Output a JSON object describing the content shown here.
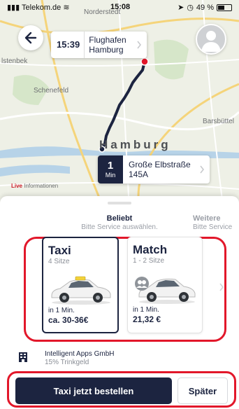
{
  "status_bar": {
    "carrier": "Telekom.de",
    "time": "15:08",
    "battery": "49 %",
    "battery_level": 0.49
  },
  "map": {
    "places": {
      "norderstedt": "Norderstedt",
      "elstenbek": "lstenbek",
      "schenefeld": "Schenefeld",
      "barsbuettel": "Barsbüttel",
      "hamburg": "Hamburg"
    },
    "attribution": {
      "live": "Live",
      "text": "Informationen"
    },
    "route_color": "#1c2440",
    "destination_color": "#e2172a"
  },
  "destination": {
    "time": "15:39",
    "line1": "Flughafen",
    "line2": "Hamburg"
  },
  "origin": {
    "minutes": "1",
    "unit": "Min",
    "line1": "Große Elbstraße",
    "line2": "145A"
  },
  "tabs": [
    {
      "title": "Beliebt",
      "subtitle": "Bitte Service auswählen."
    },
    {
      "title": "Weitere",
      "subtitle": "Bitte Service"
    }
  ],
  "services": [
    {
      "name": "Taxi",
      "seats": "4 Sitze",
      "eta": "in 1 Min.",
      "price": "ca. 30-36€",
      "selected": true
    },
    {
      "name": "Match",
      "seats": "1 - 2 Sitze",
      "eta": "in 1 Min.",
      "price": "21,32 €",
      "selected": false
    }
  ],
  "company": {
    "name": "Intelligent Apps GmbH",
    "tip": "15% Trinkgeld"
  },
  "buttons": {
    "order": "Taxi jetzt bestellen",
    "later": "Später"
  },
  "colors": {
    "primary": "#1c2440",
    "highlight": "#e2172a",
    "taxi_yellow": "#f3d23a"
  }
}
